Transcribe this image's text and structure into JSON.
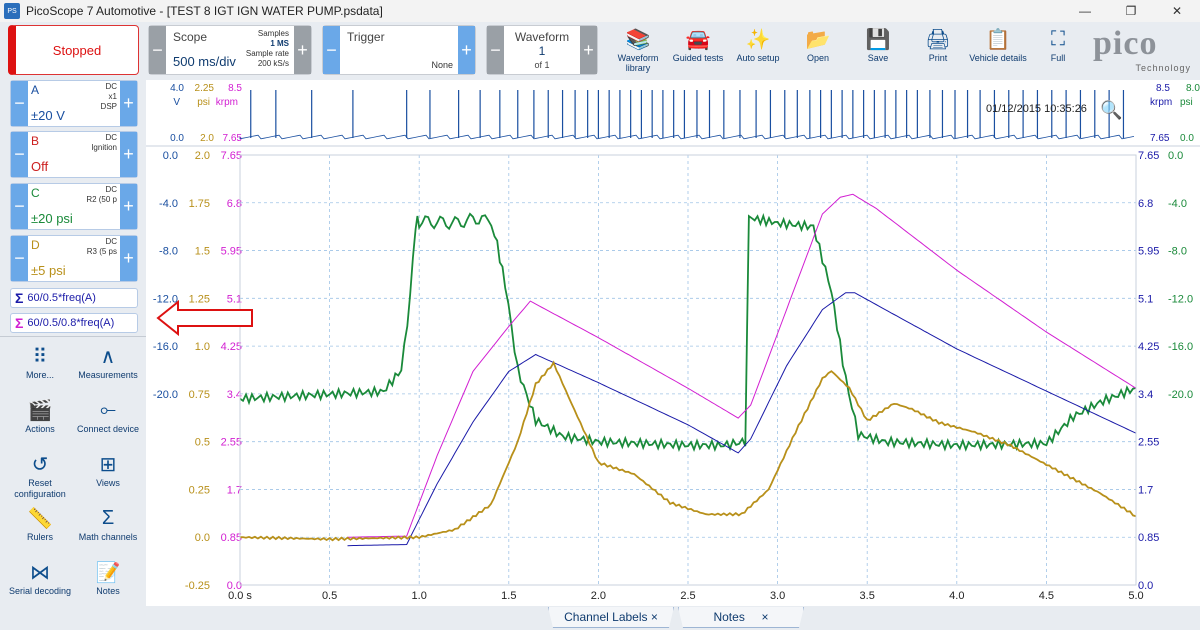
{
  "window": {
    "app_icon": "PS",
    "title": "PicoScope 7 Automotive - [TEST 8  IGT IGN WATER PUMP.psdata]",
    "minimize": "—",
    "maximize": "❐",
    "close": "✕"
  },
  "toolbar": {
    "run_state": "Stopped",
    "scope": {
      "label": "Scope",
      "value": "500 ms/div",
      "samples_label": "Samples",
      "samples_value": "1 MS",
      "rate_label": "Sample rate",
      "rate_value": "200 kS/s"
    },
    "trigger": {
      "label": "Trigger",
      "value": "None"
    },
    "waveform": {
      "label": "Waveform",
      "value": "1",
      "of": "of 1"
    },
    "buttons": [
      {
        "label": "Waveform library",
        "icon": "book-stack-icon"
      },
      {
        "label": "Guided tests",
        "icon": "car-icon"
      },
      {
        "label": "Auto setup",
        "icon": "wand-icon"
      },
      {
        "label": "Open",
        "icon": "folder-icon"
      },
      {
        "label": "Save",
        "icon": "save-icon"
      },
      {
        "label": "Print",
        "icon": "printer-icon"
      },
      {
        "label": "Vehicle details",
        "icon": "clipboard-icon"
      },
      {
        "label": "Full",
        "icon": "fullscreen-icon"
      }
    ],
    "logo": "pico",
    "logo_sub": "Technology"
  },
  "channels": [
    {
      "letter": "A",
      "coupling": "DC",
      "extra1": "x1",
      "extra2": "DSP",
      "range": "±20 V",
      "color": "#1a4fa0"
    },
    {
      "letter": "B",
      "coupling": "DC",
      "extra1": "Ignition",
      "extra2": "",
      "range": "Off",
      "color": "#cc1f1f"
    },
    {
      "letter": "C",
      "coupling": "DC",
      "extra1": "R2 (50 p",
      "extra2": "",
      "range": "±20 psi",
      "color": "#1a8a3a"
    },
    {
      "letter": "D",
      "coupling": "DC",
      "extra1": "R3 (5 ps",
      "extra2": "",
      "range": "±5 psi",
      "color": "#b8901a"
    }
  ],
  "math_channels": [
    {
      "label": "60/0.5*freq(A)",
      "color": "#1a1aa8"
    },
    {
      "label": "60/0.5/0.8*freq(A)",
      "color": "#d21fd2"
    }
  ],
  "tools": [
    {
      "label": "More...",
      "icon": "grid-dots-icon"
    },
    {
      "label": "Measurements",
      "icon": "compass-icon"
    },
    {
      "label": "Actions",
      "icon": "clapperboard-icon"
    },
    {
      "label": "Connect device",
      "icon": "usb-icon"
    },
    {
      "label": "Reset configuration",
      "icon": "reset-icon"
    },
    {
      "label": "Views",
      "icon": "views-grid-icon"
    },
    {
      "label": "Rulers",
      "icon": "ruler-icon"
    },
    {
      "label": "Math channels",
      "icon": "sigma-icon"
    },
    {
      "label": "Serial decoding",
      "icon": "serial-decode-icon"
    },
    {
      "label": "Notes",
      "icon": "notes-icon"
    }
  ],
  "bottom_tabs": [
    {
      "label": "Channel Labels",
      "close": "×"
    },
    {
      "label": "Notes",
      "close": "×"
    }
  ],
  "chart_data": {
    "type": "line",
    "timestamp": "01/12/2015 10:35:26",
    "upper_pane": {
      "axes": {
        "left_units": [
          "V",
          "psi",
          "krpm"
        ],
        "left_top_values": [
          "4.0",
          "2.25",
          "8.5"
        ],
        "left_bottom_values": [
          "0.0",
          "2.0",
          "7.65"
        ],
        "right_units": [
          "krpm",
          "psi"
        ],
        "right_top_values": [
          "8.5",
          "8.0"
        ],
        "right_bottom_values": [
          "7.65",
          "0.0"
        ]
      },
      "series": [
        {
          "channel": "A",
          "color": "#1a4fa0",
          "description": "ignition pulses",
          "pulse_times_s": [
            0.06,
            0.2,
            0.4,
            0.63,
            0.93,
            1.06,
            1.22,
            1.34,
            1.45,
            1.55,
            1.64,
            1.72,
            1.8,
            1.87,
            1.94,
            2.0,
            2.06,
            2.12,
            2.18,
            2.24,
            2.3,
            2.36,
            2.42,
            2.48,
            2.55,
            2.62,
            2.7,
            2.79,
            2.88,
            2.96,
            3.04,
            3.11,
            3.18,
            3.24,
            3.3,
            3.36,
            3.42,
            3.48,
            3.54,
            3.6,
            3.66,
            3.72,
            3.78,
            3.85,
            3.92,
            3.99,
            4.06,
            4.13,
            4.21,
            4.29,
            4.37,
            4.45,
            4.53,
            4.61,
            4.69,
            4.77,
            4.85,
            4.93
          ]
        }
      ]
    },
    "lower_pane": {
      "x": {
        "ticks": [
          "0.0 s",
          "0.5",
          "1.0",
          "1.5",
          "2.0",
          "2.5",
          "3.0",
          "3.5",
          "4.0",
          "4.5",
          "5.0"
        ],
        "range": [
          0,
          5
        ]
      },
      "left_axes": [
        {
          "unit": "V",
          "color": "#1a4fa0",
          "ticks": [
            "0.0",
            "-4.0",
            "-8.0",
            "-12.0",
            "-16.0",
            "-20.0"
          ],
          "range": [
            -24,
            0
          ]
        },
        {
          "unit": "psi",
          "color": "#b8901a",
          "ticks": [
            "2.0",
            "1.75",
            "1.5",
            "1.25",
            "1.0",
            "0.75",
            "0.5",
            "0.25",
            "0.0",
            "-0.25"
          ],
          "range": [
            -0.25,
            2.0
          ]
        },
        {
          "unit": "krpm",
          "color": "#d21fd2",
          "ticks": [
            "7.65",
            "6.8",
            "5.95",
            "5.1",
            "4.25",
            "3.4",
            "2.55",
            "1.7",
            "0.85",
            "0.0"
          ],
          "range": [
            0,
            7.65
          ]
        }
      ],
      "right_axes": [
        {
          "unit": "krpm",
          "color": "#1a1aa8",
          "ticks": [
            "7.65",
            "6.8",
            "5.95",
            "5.1",
            "4.25",
            "3.4",
            "2.55",
            "1.7",
            "0.85",
            "0.0"
          ],
          "range": [
            0,
            7.65
          ]
        },
        {
          "unit": "psi",
          "color": "#1a8a3a",
          "ticks": [
            "0.0",
            "-4.0",
            "-8.0",
            "-12.0",
            "-16.0",
            "-20.0"
          ],
          "range": [
            -24,
            0
          ]
        }
      ],
      "series": [
        {
          "channel": "C",
          "color": "#1a8a3a",
          "unit": "psi",
          "points": [
            [
              0,
              -13.6
            ],
            [
              0.8,
              -13.2
            ],
            [
              0.9,
              -12
            ],
            [
              0.95,
              -8
            ],
            [
              0.98,
              -3.8
            ],
            [
              1.0,
              -3.7
            ],
            [
              1.2,
              -3.8
            ],
            [
              1.35,
              -3.5
            ],
            [
              1.42,
              -4.3
            ],
            [
              1.48,
              -7.2
            ],
            [
              1.55,
              -12
            ],
            [
              1.65,
              -14.8
            ],
            [
              1.8,
              -15.7
            ],
            [
              2.0,
              -16.0
            ],
            [
              2.5,
              -16.2
            ],
            [
              2.7,
              -16.2
            ],
            [
              2.82,
              -16.0
            ],
            [
              2.84,
              -3.5
            ],
            [
              3.0,
              -3.8
            ],
            [
              3.2,
              -4.0
            ],
            [
              3.3,
              -7.6
            ],
            [
              3.38,
              -12.5
            ],
            [
              3.45,
              -15.6
            ],
            [
              3.6,
              -16.0
            ],
            [
              4.0,
              -16.2
            ],
            [
              4.5,
              -16.1
            ],
            [
              4.65,
              -14.6
            ],
            [
              4.8,
              -13.8
            ],
            [
              5.0,
              -13.0
            ]
          ]
        },
        {
          "channel": "math1",
          "color": "#d21fd2",
          "unit": "krpm",
          "points": [
            [
              0.6,
              0.85
            ],
            [
              0.93,
              0.87
            ],
            [
              1.1,
              2.3
            ],
            [
              1.3,
              3.8
            ],
            [
              1.5,
              4.6
            ],
            [
              1.62,
              5.05
            ],
            [
              2.0,
              4.4
            ],
            [
              2.5,
              3.5
            ],
            [
              2.78,
              2.97
            ],
            [
              2.85,
              3.2
            ],
            [
              3.05,
              4.9
            ],
            [
              3.25,
              6.6
            ],
            [
              3.35,
              6.9
            ],
            [
              3.42,
              6.95
            ],
            [
              3.55,
              6.7
            ],
            [
              4.0,
              5.6
            ],
            [
              4.5,
              4.5
            ],
            [
              5.0,
              3.5
            ]
          ]
        },
        {
          "channel": "math2",
          "color": "#1a1aa8",
          "unit": "krpm",
          "points": [
            [
              0.6,
              0.7
            ],
            [
              0.93,
              0.72
            ],
            [
              1.1,
              1.8
            ],
            [
              1.3,
              2.9
            ],
            [
              1.5,
              3.8
            ],
            [
              1.65,
              4.1
            ],
            [
              2.0,
              3.6
            ],
            [
              2.5,
              2.85
            ],
            [
              2.78,
              2.35
            ],
            [
              2.85,
              2.6
            ],
            [
              3.05,
              3.9
            ],
            [
              3.25,
              4.9
            ],
            [
              3.38,
              5.2
            ],
            [
              3.43,
              5.2
            ],
            [
              3.6,
              4.9
            ],
            [
              4.0,
              4.2
            ],
            [
              4.5,
              3.45
            ],
            [
              5.0,
              2.7
            ]
          ]
        },
        {
          "channel": "D",
          "color": "#b8901a",
          "unit": "psi",
          "points": [
            [
              0,
              0.0
            ],
            [
              0.5,
              -0.01
            ],
            [
              1.0,
              0.0
            ],
            [
              1.2,
              0.04
            ],
            [
              1.4,
              0.17
            ],
            [
              1.55,
              0.5
            ],
            [
              1.65,
              0.8
            ],
            [
              1.75,
              0.91
            ],
            [
              1.85,
              0.7
            ],
            [
              2.0,
              0.39
            ],
            [
              2.2,
              0.33
            ],
            [
              2.4,
              0.18
            ],
            [
              2.6,
              0.12
            ],
            [
              2.8,
              0.12
            ],
            [
              2.95,
              0.25
            ],
            [
              3.1,
              0.55
            ],
            [
              3.25,
              0.83
            ],
            [
              3.3,
              0.87
            ],
            [
              3.4,
              0.78
            ],
            [
              3.5,
              0.61
            ],
            [
              3.65,
              0.7
            ],
            [
              3.75,
              0.67
            ],
            [
              3.9,
              0.6
            ],
            [
              4.1,
              0.55
            ],
            [
              4.3,
              0.48
            ],
            [
              4.6,
              0.33
            ],
            [
              4.8,
              0.23
            ],
            [
              5.0,
              0.11
            ]
          ]
        }
      ]
    }
  }
}
